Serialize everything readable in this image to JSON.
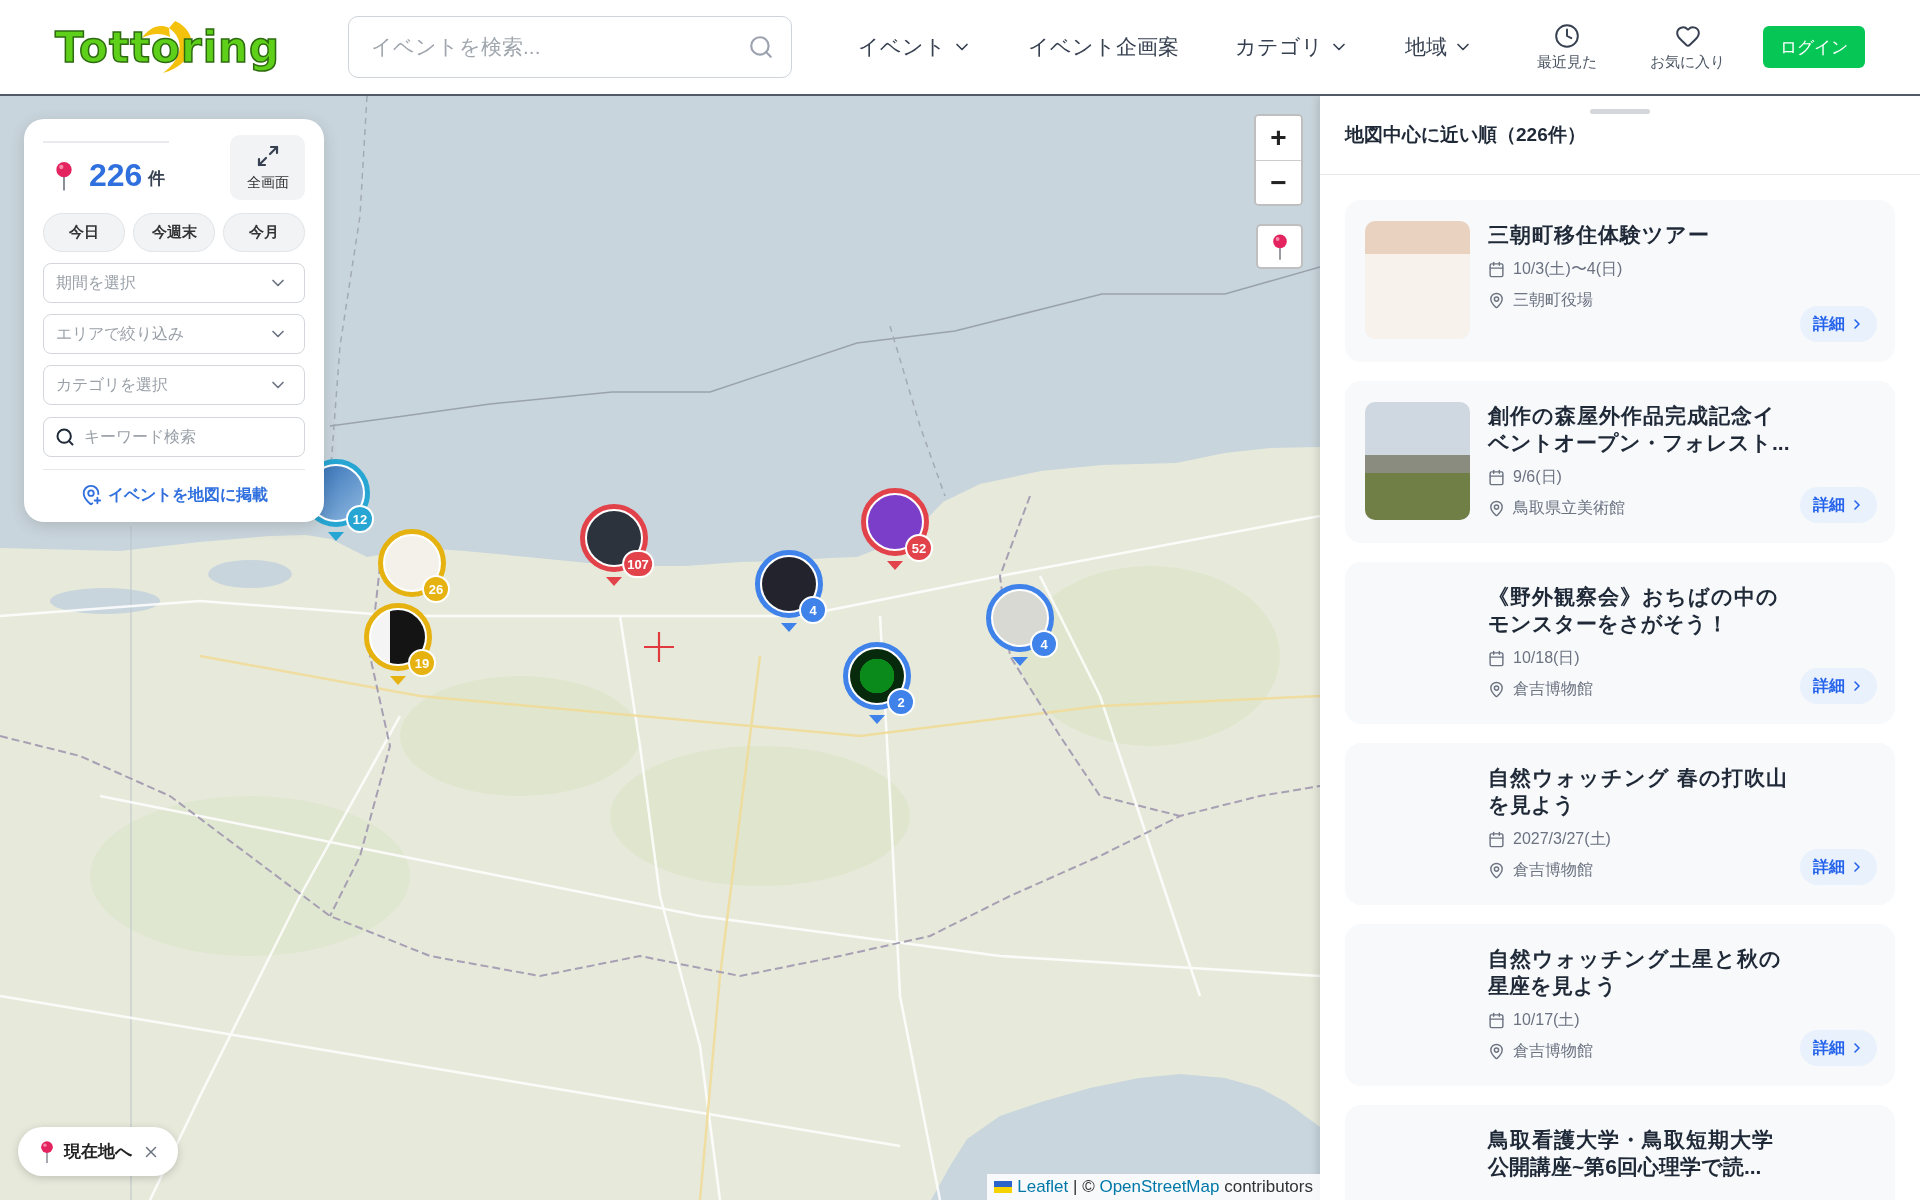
{
  "header": {
    "logo": "Tottoring",
    "search": {
      "placeholder": "イベントを検索..."
    },
    "nav": [
      {
        "label": "イベント",
        "dropdown": true
      },
      {
        "label": "イベント企画案",
        "dropdown": false
      },
      {
        "label": "カテゴリ",
        "dropdown": true
      },
      {
        "label": "地域",
        "dropdown": true
      }
    ],
    "shortcuts": [
      {
        "kind": "recent",
        "label": "最近見た"
      },
      {
        "kind": "favorites",
        "label": "お気に入り"
      }
    ],
    "login": "ログイン"
  },
  "filter_panel": {
    "count": "226",
    "count_unit": "件",
    "fullscreen": "全画面",
    "quick_ranges": [
      {
        "label": "今日",
        "selected": false
      },
      {
        "label": "今週末",
        "selected": false
      },
      {
        "label": "今月",
        "selected": false
      }
    ],
    "selects": [
      {
        "placeholder": "期間を選択"
      },
      {
        "placeholder": "エリアで絞り込み"
      },
      {
        "placeholder": "カテゴリを選択"
      }
    ],
    "keyword": {
      "placeholder": "キーワード検索"
    },
    "post_link": "イベントを地図に掲載"
  },
  "map": {
    "zoom_in": "+",
    "zoom_out": "−",
    "markers": [
      {
        "count": "12",
        "color": "#27a6d3"
      },
      {
        "count": "26",
        "color": "#e5b20f"
      },
      {
        "count": "19",
        "color": "#e5b20f"
      },
      {
        "count": "107",
        "color": "#e2434b"
      },
      {
        "count": "4",
        "color": "#3f82ea"
      },
      {
        "count": "52",
        "color": "#e2434b"
      },
      {
        "count": "2",
        "color": "#3f82ea"
      },
      {
        "count": "4",
        "color": "#3f82ea"
      }
    ],
    "locate_button": "現在地へ",
    "attribution": {
      "leaflet": "Leaflet",
      "middle": "| ©",
      "osm": "OpenStreetMap",
      "suffix": "contributors"
    }
  },
  "list": {
    "title": "地図中心に近い順（226件）",
    "events": [
      {
        "title": "三朝町移住体験ツアー",
        "image": true,
        "date": "10/3(土)〜4(日)",
        "place": "三朝町役場",
        "detail": "詳細"
      },
      {
        "title": "創作の森屋外作品完成記念イベントオープン・フォレスト...",
        "image": true,
        "date": "9/6(日)",
        "place": "鳥取県立美術館",
        "detail": "詳細"
      },
      {
        "title": "《野外観察会》おちばの中のモンスターをさがそう！",
        "image": false,
        "date": "10/18(日)",
        "place": "倉吉博物館",
        "detail": "詳細"
      },
      {
        "title": "自然ウォッチング 春の打吹山を見よう",
        "image": false,
        "date": "2027/3/27(土)",
        "place": "倉吉博物館",
        "detail": "詳細"
      },
      {
        "title": "自然ウォッチング土星と秋の星座を見よう",
        "image": false,
        "date": "10/17(土)",
        "place": "倉吉博物館",
        "detail": "詳細"
      },
      {
        "title": "鳥取看護大学・鳥取短期大学公開講座~第6回心理学で読...",
        "image": false
      }
    ]
  }
}
